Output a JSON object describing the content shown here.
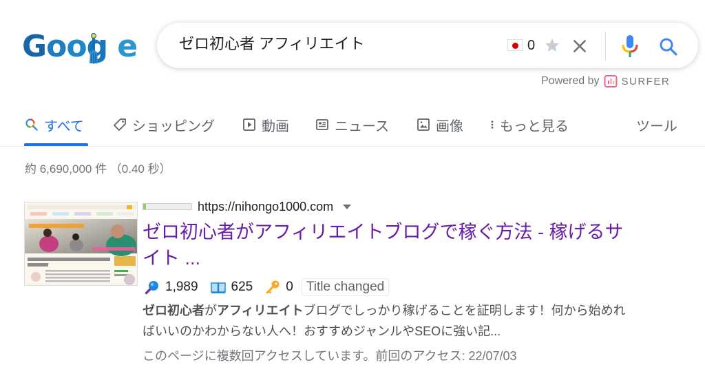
{
  "logo": {
    "text": "Google",
    "letters": [
      "G",
      "o",
      "o",
      "g",
      "l",
      "e"
    ]
  },
  "search": {
    "query": "ゼロ初心者 アフィリエイト",
    "counter_value": "0",
    "icons": [
      "flag-jp-icon",
      "star-icon",
      "close-icon",
      "mic-icon",
      "search-icon"
    ]
  },
  "powered_by": {
    "label": "Powered by",
    "brand": "SURFER"
  },
  "tabs": [
    {
      "label": "すべて",
      "icon": "search-icon",
      "active": true
    },
    {
      "label": "ショッピング",
      "icon": "tag-icon",
      "active": false
    },
    {
      "label": "動画",
      "icon": "play-icon",
      "active": false
    },
    {
      "label": "ニュース",
      "icon": "news-icon",
      "active": false
    },
    {
      "label": "画像",
      "icon": "image-icon",
      "active": false
    },
    {
      "label": "もっと見る",
      "icon": "more-vert-icon",
      "active": false
    }
  ],
  "tools_label": "ツール",
  "result_stats": "約 6,690,000 件 （0.40 秒）",
  "result": {
    "url": "https://nihongo1000.com",
    "title": "ゼロ初心者がアフィリエイトブログで稼ぐ方法 - 稼げるサイト ...",
    "metrics": [
      {
        "icon": "magnifier-icon",
        "value": "1,989"
      },
      {
        "icon": "book-icon",
        "value": "625"
      },
      {
        "icon": "key-icon",
        "value": "0"
      }
    ],
    "badge": "Title changed",
    "snippet": {
      "bold1": "ゼロ初心者",
      "text1": "が",
      "bold2": "アフィリエイト",
      "text2": "ブログでしっかり稼げることを証明します！何から始めればいいのかわからない人へ！おすすめジャンルやSEOに強い記..."
    },
    "visited_note": "このページに複数回アクセスしています。前回のアクセス: 22/07/03",
    "thumbnail": {
      "heading": "ゼロから初心者がアフィリエイトで稼ぐ方法をまとめました。",
      "banner": "ゼロ初心者がアフィリエイトで稼ぐ方法"
    }
  },
  "colors": {
    "link_visited": "#681da8",
    "accent": "#1a73e8",
    "text_secondary": "#70757a"
  }
}
